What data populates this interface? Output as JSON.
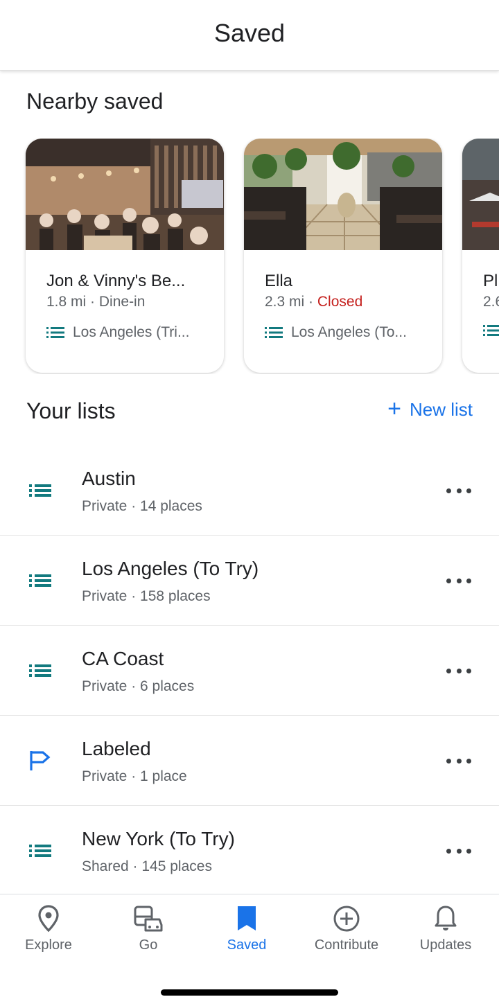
{
  "header": {
    "title": "Saved"
  },
  "nearby": {
    "title": "Nearby saved",
    "cards": [
      {
        "name": "Jon & Vinny's Be...",
        "distance": "1.8 mi",
        "sep": "·",
        "detail": "Dine-in",
        "list": "Los Angeles (Tri..."
      },
      {
        "name": "Ella",
        "distance": "2.3 mi",
        "sep": "·",
        "detail": "Closed",
        "list": "Los Angeles (To..."
      },
      {
        "name": "Pl",
        "distance": "2.6",
        "sep": "",
        "detail": "",
        "list": ""
      }
    ]
  },
  "lists": {
    "title": "Your lists",
    "new_list_label": "New list",
    "items": [
      {
        "name": "Austin",
        "subtitle": "Private · 14 places",
        "icon": "list-icon"
      },
      {
        "name": "Los Angeles (To Try)",
        "subtitle": "Private · 158 places",
        "icon": "list-icon"
      },
      {
        "name": "CA Coast",
        "subtitle": "Private · 6 places",
        "icon": "list-icon"
      },
      {
        "name": "Labeled",
        "subtitle": "Private · 1 place",
        "icon": "flag-icon"
      },
      {
        "name": "New York (To Try)",
        "subtitle": "Shared · 145 places",
        "icon": "list-icon"
      }
    ]
  },
  "nav": {
    "items": [
      {
        "label": "Explore",
        "icon": "location-pin-icon"
      },
      {
        "label": "Go",
        "icon": "commute-icon"
      },
      {
        "label": "Saved",
        "icon": "bookmark-icon",
        "active": true
      },
      {
        "label": "Contribute",
        "icon": "add-circle-icon"
      },
      {
        "label": "Updates",
        "icon": "bell-icon"
      }
    ]
  },
  "colors": {
    "accent": "#1a73e8",
    "list_icon": "#137a7f",
    "closed": "#c5221f",
    "text_secondary": "#5f6368"
  }
}
